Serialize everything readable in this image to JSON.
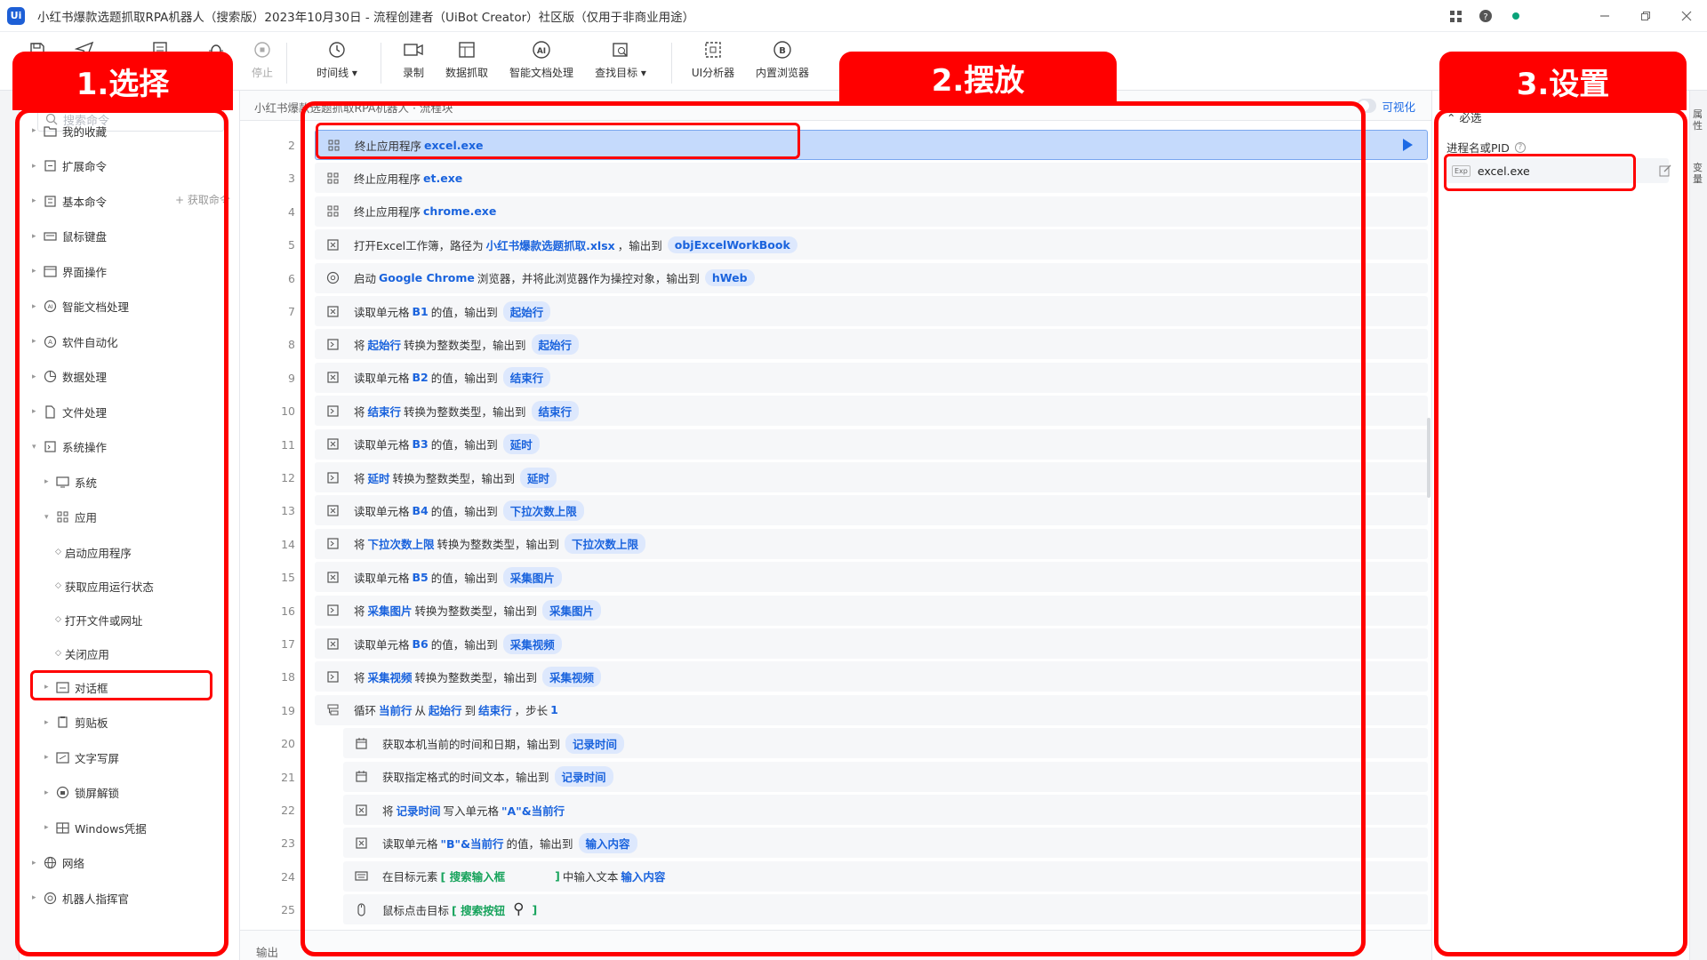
{
  "window": {
    "logo": "Ui",
    "title": "小红书爆款选题抓取RPA机器人（搜索版）2023年10月30日 - 流程创建者（UiBot Creator）社区版（仅用于非商业用途）"
  },
  "toolbar": [
    {
      "icon": "save-icon",
      "label": ""
    },
    {
      "icon": "send-icon",
      "label": ""
    },
    {
      "icon": "board-icon",
      "label": ""
    },
    {
      "icon": "bug-icon",
      "label": ""
    },
    {
      "icon": "stop-icon",
      "label": "停止"
    },
    {
      "icon": "clock-icon",
      "label": "时间线 ▾"
    },
    {
      "icon": "record-icon",
      "label": "录制"
    },
    {
      "icon": "data-scrape-icon",
      "label": "数据抓取"
    },
    {
      "icon": "ai-doc-icon",
      "label": "智能文档处理"
    },
    {
      "icon": "find-target-icon",
      "label": "查找目标 ▾"
    },
    {
      "icon": "ui-analyzer-icon",
      "label": "UI分析器"
    },
    {
      "icon": "browser-icon",
      "label": "内置浏览器"
    }
  ],
  "left_panel": {
    "search_placeholder": "搜索命令",
    "add_command": "+ 获取命令",
    "tree": [
      {
        "label": "我的收藏",
        "icon": "folder-icon",
        "level": 0
      },
      {
        "label": "扩展命令",
        "icon": "extension-icon",
        "level": 0
      },
      {
        "label": "基本命令",
        "icon": "basic-cmd-icon",
        "level": 0
      },
      {
        "label": "鼠标键盘",
        "icon": "mouse-keyboard-icon",
        "level": 0
      },
      {
        "label": "界面操作",
        "icon": "ui-operation-icon",
        "level": 0
      },
      {
        "label": "智能文档处理",
        "icon": "ai-doc-icon",
        "level": 0
      },
      {
        "label": "软件自动化",
        "icon": "software-auto-icon",
        "level": 0
      },
      {
        "label": "数据处理",
        "icon": "data-icon",
        "level": 0
      },
      {
        "label": "文件处理",
        "icon": "file-icon",
        "level": 0
      },
      {
        "label": "系统操作",
        "icon": "system-op-icon",
        "level": 0
      },
      {
        "label": "系统",
        "icon": "system-icon",
        "level": 1
      },
      {
        "label": "应用",
        "icon": "app-grid-icon",
        "level": 1
      },
      {
        "label": "启动应用程序",
        "icon": "",
        "level": 2
      },
      {
        "label": "获取应用运行状态",
        "icon": "",
        "level": 2
      },
      {
        "label": "打开文件或网址",
        "icon": "",
        "level": 2
      },
      {
        "label": "关闭应用",
        "icon": "",
        "level": 2
      },
      {
        "label": "对话框",
        "icon": "dialog-icon",
        "level": 1
      },
      {
        "label": "剪贴板",
        "icon": "clipboard-icon",
        "level": 1
      },
      {
        "label": "文字写屏",
        "icon": "screen-text-icon",
        "level": 1
      },
      {
        "label": "锁屏解锁",
        "icon": "lock-icon",
        "level": 1
      },
      {
        "label": "Windows凭据",
        "icon": "credential-icon",
        "level": 1
      },
      {
        "label": "网络",
        "icon": "network-icon",
        "level": 0
      },
      {
        "label": "机器人指挥官",
        "icon": "commander-icon",
        "level": 0
      }
    ]
  },
  "center": {
    "tab_title": "小红书爆款选题抓取RPA机器人 · 流程块",
    "visual_toggle": "可视化",
    "output_label": "输出",
    "rows": [
      {
        "line": "2",
        "indent": 0,
        "icon": "app-grid-icon",
        "selected": true,
        "parts": [
          {
            "t": "终止应用程序"
          },
          {
            "h": "excel.exe"
          }
        ]
      },
      {
        "line": "3",
        "indent": 0,
        "icon": "app-grid-icon",
        "parts": [
          {
            "t": "终止应用程序"
          },
          {
            "h": "et.exe"
          }
        ]
      },
      {
        "line": "4",
        "indent": 0,
        "icon": "app-grid-icon",
        "parts": [
          {
            "t": "终止应用程序"
          },
          {
            "h": "chrome.exe"
          }
        ]
      },
      {
        "line": "5",
        "indent": 0,
        "icon": "excel-icon",
        "parts": [
          {
            "t": "打开Excel工作簿，路径为"
          },
          {
            "h": "小红书爆款选题抓取.xlsx"
          },
          {
            "t": "，输出到"
          },
          {
            "p": "objExcelWorkBook"
          }
        ]
      },
      {
        "line": "6",
        "indent": 0,
        "icon": "browser-icon",
        "parts": [
          {
            "t": "启动"
          },
          {
            "h": "Google Chrome"
          },
          {
            "t": "浏览器，并将此浏览器作为操控对象，输出到"
          },
          {
            "p": "hWeb"
          }
        ]
      },
      {
        "line": "7",
        "indent": 0,
        "icon": "excel-icon",
        "parts": [
          {
            "t": "读取单元格"
          },
          {
            "h": "B1"
          },
          {
            "t": "的值，输出到"
          },
          {
            "p": "起始行"
          }
        ]
      },
      {
        "line": "8",
        "indent": 0,
        "icon": "convert-icon",
        "parts": [
          {
            "t": "将"
          },
          {
            "h": "起始行"
          },
          {
            "t": "转换为整数类型，输出到"
          },
          {
            "p": "起始行"
          }
        ]
      },
      {
        "line": "9",
        "indent": 0,
        "icon": "excel-icon",
        "parts": [
          {
            "t": "读取单元格"
          },
          {
            "h": "B2"
          },
          {
            "t": "的值，输出到"
          },
          {
            "p": "结束行"
          }
        ]
      },
      {
        "line": "10",
        "indent": 0,
        "icon": "convert-icon",
        "parts": [
          {
            "t": "将"
          },
          {
            "h": "结束行"
          },
          {
            "t": "转换为整数类型，输出到"
          },
          {
            "p": "结束行"
          }
        ]
      },
      {
        "line": "11",
        "indent": 0,
        "icon": "excel-icon",
        "parts": [
          {
            "t": "读取单元格"
          },
          {
            "h": "B3"
          },
          {
            "t": "的值，输出到"
          },
          {
            "p": "延时"
          }
        ]
      },
      {
        "line": "12",
        "indent": 0,
        "icon": "convert-icon",
        "parts": [
          {
            "t": "将"
          },
          {
            "h": "延时"
          },
          {
            "t": "转换为整数类型，输出到"
          },
          {
            "p": "延时"
          }
        ]
      },
      {
        "line": "13",
        "indent": 0,
        "icon": "excel-icon",
        "parts": [
          {
            "t": "读取单元格"
          },
          {
            "h": "B4"
          },
          {
            "t": "的值，输出到"
          },
          {
            "p": "下拉次数上限"
          }
        ]
      },
      {
        "line": "14",
        "indent": 0,
        "icon": "convert-icon",
        "parts": [
          {
            "t": "将"
          },
          {
            "h": "下拉次数上限"
          },
          {
            "t": "转换为整数类型，输出到"
          },
          {
            "p": "下拉次数上限"
          }
        ]
      },
      {
        "line": "15",
        "indent": 0,
        "icon": "excel-icon",
        "parts": [
          {
            "t": "读取单元格"
          },
          {
            "h": "B5"
          },
          {
            "t": "的值，输出到"
          },
          {
            "p": "采集图片"
          }
        ]
      },
      {
        "line": "16",
        "indent": 0,
        "icon": "convert-icon",
        "parts": [
          {
            "t": "将"
          },
          {
            "h": "采集图片"
          },
          {
            "t": "转换为整数类型，输出到"
          },
          {
            "p": "采集图片"
          }
        ]
      },
      {
        "line": "17",
        "indent": 0,
        "icon": "excel-icon",
        "parts": [
          {
            "t": "读取单元格"
          },
          {
            "h": "B6"
          },
          {
            "t": "的值，输出到"
          },
          {
            "p": "采集视频"
          }
        ]
      },
      {
        "line": "18",
        "indent": 0,
        "icon": "convert-icon",
        "parts": [
          {
            "t": "将"
          },
          {
            "h": "采集视频"
          },
          {
            "t": "转换为整数类型，输出到"
          },
          {
            "p": "采集视频"
          }
        ]
      },
      {
        "line": "19",
        "indent": 0,
        "icon": "loop-icon",
        "parts": [
          {
            "t": "循环"
          },
          {
            "h": "当前行"
          },
          {
            "t": "从"
          },
          {
            "h": "起始行"
          },
          {
            "t": "到"
          },
          {
            "h": "结束行"
          },
          {
            "t": "，步长"
          },
          {
            "h": "1"
          }
        ]
      },
      {
        "line": "20",
        "indent": 1,
        "icon": "calendar-icon",
        "parts": [
          {
            "t": "获取本机当前的时间和日期，输出到"
          },
          {
            "p": "记录时间"
          }
        ]
      },
      {
        "line": "21",
        "indent": 1,
        "icon": "calendar-icon",
        "parts": [
          {
            "t": "获取指定格式的时间文本，输出到"
          },
          {
            "p": "记录时间"
          }
        ]
      },
      {
        "line": "22",
        "indent": 1,
        "icon": "excel-icon",
        "parts": [
          {
            "t": "将"
          },
          {
            "h": "记录时间"
          },
          {
            "t": "写入单元格"
          },
          {
            "h": "\"A\"&当前行"
          }
        ]
      },
      {
        "line": "23",
        "indent": 1,
        "icon": "excel-icon",
        "parts": [
          {
            "t": "读取单元格"
          },
          {
            "h": "\"B\"&当前行"
          },
          {
            "t": "的值，输出到"
          },
          {
            "p": "输入内容"
          }
        ]
      },
      {
        "line": "24",
        "indent": 1,
        "icon": "keyboard-icon",
        "parts": [
          {
            "t": "在目标元素"
          },
          {
            "g": "[ 搜索输入框"
          },
          {
            "t": "　　　　"
          },
          {
            "g": "]"
          },
          {
            "t": "中输入文本"
          },
          {
            "h": "输入内容"
          }
        ]
      },
      {
        "line": "25",
        "indent": 1,
        "icon": "mouse-icon",
        "parts": [
          {
            "t": "鼠标点击目标"
          },
          {
            "g": "[ 搜索按钮"
          },
          {
            "s": "⚲"
          },
          {
            "g": "]"
          }
        ]
      }
    ]
  },
  "right_panel": {
    "section": "⌃ 必选",
    "field_label": "进程名或PID",
    "field_help": "?",
    "field_tag": "Exp",
    "field_value": "excel.exe"
  },
  "side_tabs": {
    "right_1": "属性",
    "right_2": "变量"
  },
  "annotations": [
    {
      "label": "1.选择"
    },
    {
      "label": "2.摆放"
    },
    {
      "label": "3.设置"
    }
  ],
  "colors": {
    "accent": "#1d6ae5",
    "annotation": "#ff0000",
    "selected_row": "#c5dafc",
    "variable_pill": "#dde8fd"
  }
}
